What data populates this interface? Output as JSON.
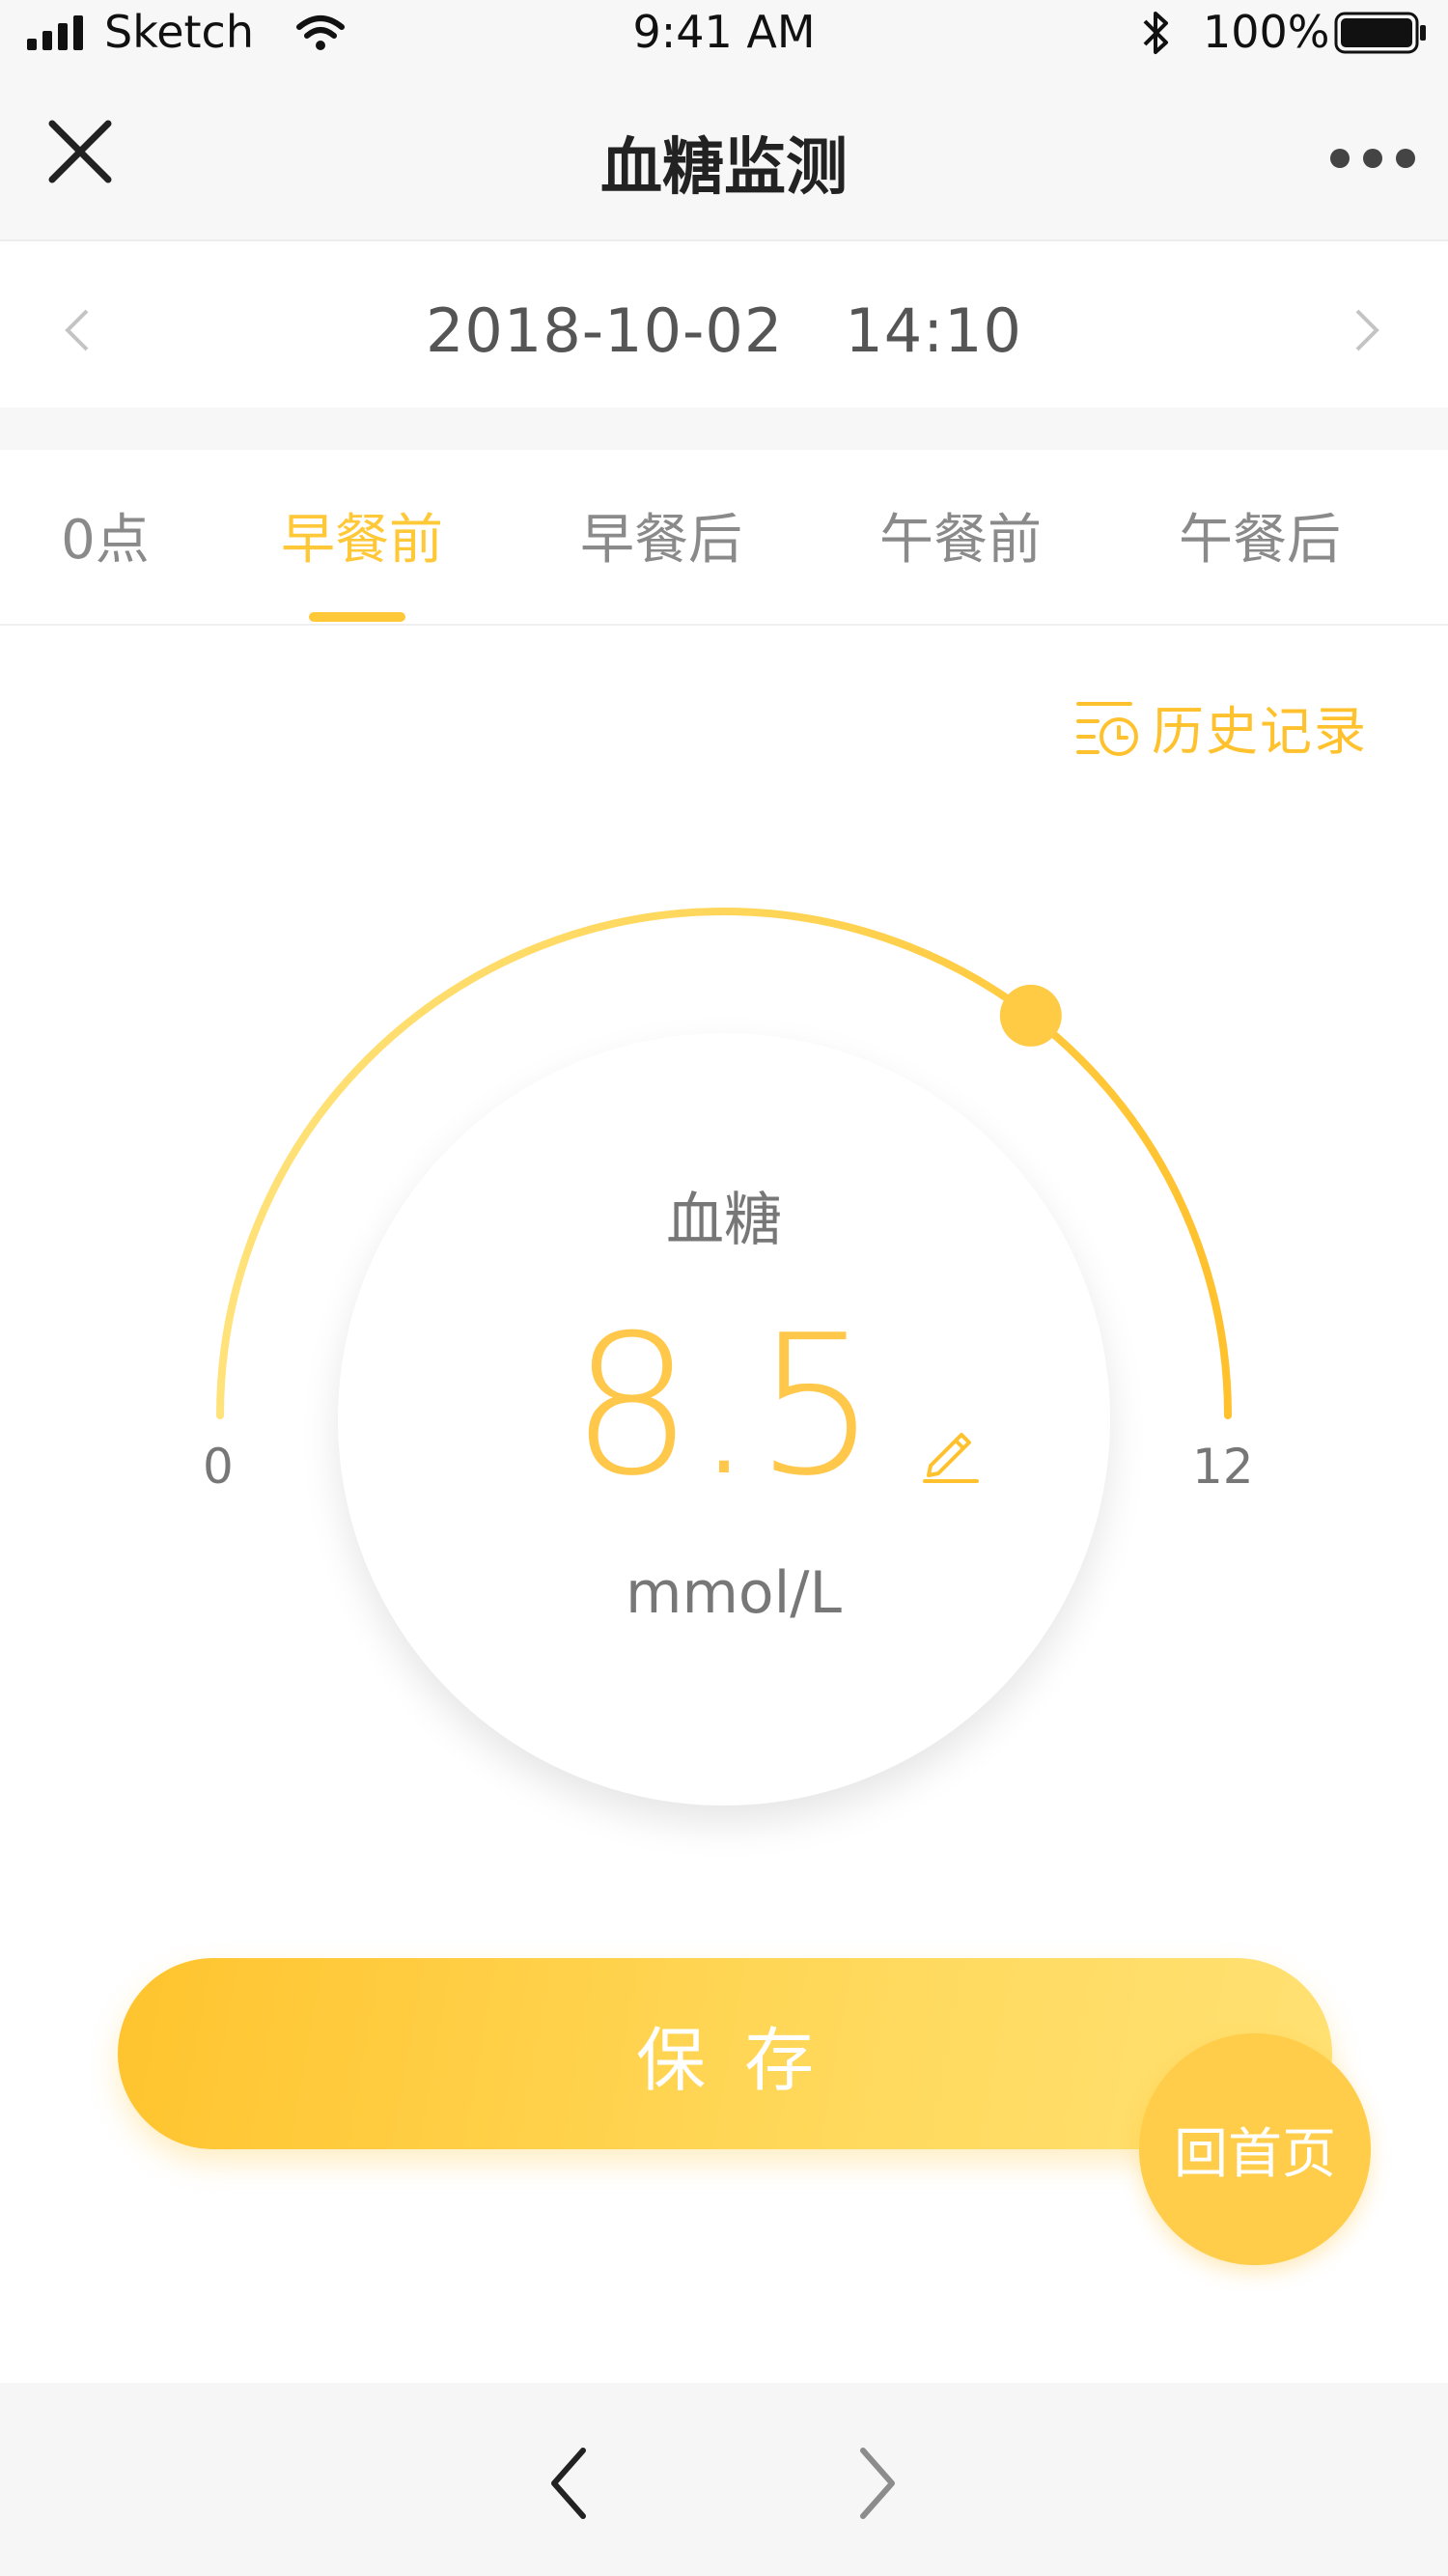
{
  "status_bar": {
    "carrier": "Sketch",
    "time": "9:41 AM",
    "battery": "100%"
  },
  "nav": {
    "title": "血糖监测",
    "close_icon": "close-icon",
    "more_icon": "more-icon"
  },
  "date_row": {
    "date": "2018-10-02",
    "time": "14:10",
    "prev_icon": "chevron-left-icon",
    "next_icon": "chevron-right-icon"
  },
  "tabs": [
    {
      "label": "0点",
      "active": false
    },
    {
      "label": "早餐前",
      "active": true
    },
    {
      "label": "早餐后",
      "active": false
    },
    {
      "label": "午餐前",
      "active": false
    },
    {
      "label": "午餐后",
      "active": false
    }
  ],
  "history": {
    "label": "历史记录",
    "icon": "history-clock-icon"
  },
  "gauge": {
    "label": "血糖",
    "value": "8.5",
    "unit": "mmol/L",
    "min": "0",
    "max": "12",
    "value_number": 8.5,
    "min_number": 0,
    "max_number": 12
  },
  "save_label": "保存",
  "home_label": "回首页",
  "colors": {
    "accent": "#ffc838",
    "accent_light": "#ffe173",
    "text_gray": "#777777"
  }
}
